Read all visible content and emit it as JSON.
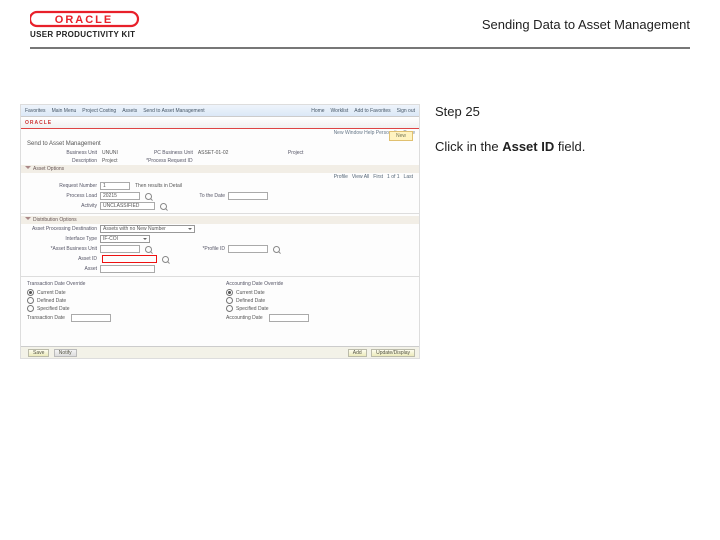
{
  "header": {
    "logo_text": "ORACLE",
    "upk": "USER PRODUCTIVITY KIT",
    "title": "Sending Data to Asset Management"
  },
  "rhs": {
    "step": "Step 25",
    "instr_pre": "Click in the ",
    "instr_bold": "Asset ID",
    "instr_post": " field."
  },
  "shot": {
    "topbar": {
      "favorites": "Favorites",
      "menu": "Main Menu",
      "pc": "Project Costing",
      "assets": "Assets",
      "send": "Send to Asset Management",
      "home": "Home",
      "worklist": "Worklist",
      "addfav": "Add to Favorites",
      "signout": "Sign out"
    },
    "brand": "ORACLE",
    "subhdr": "New Window   Help   Personalize Page",
    "page_title": "Send to Asset Management",
    "right_tab": "New",
    "trans": {
      "bu_lbl": "Business Unit",
      "bu_val": "UNUNI",
      "pc_lbl": "PC Business Unit",
      "pc_val": "ASSET-01-02",
      "proj_lbl": "Project",
      "proj_val": "",
      "desc_lbl": "Description",
      "desc_val": "Project",
      "proc_lbl": "*Process Request ID",
      "proc_val": "",
      "seq_lbl": "Request Number",
      "seq_val": "1",
      "seq_val2": "Then results in Detail",
      "prc_lbl": "Process Load",
      "prc_val": "20215",
      "todt_lbl": "To the Date",
      "todt_val": "",
      "act_lbl": "Activity",
      "act_val": "UNCLASSIFIED"
    },
    "nav": {
      "viewall": "View All",
      "first": "First",
      "range": "1 of 1",
      "last": "Last",
      "prof": "Profile"
    },
    "dist_hdr": "Distribution Options",
    "asset": {
      "dest_lbl": "Asset Processing Destination",
      "dest_val": "Assets with no New Number",
      "itype_lbl": "Interface Type",
      "itype_val": "IF-COI",
      "aubu_lbl": "*Asset Business Unit",
      "aubu_val": "",
      "aid_lbl": "Asset ID",
      "prof_lbl": "*Profile ID",
      "prof_val": "",
      "assetf_lbl": "Asset"
    },
    "override": {
      "left_title": "Transaction Date Override",
      "right_title": "Accounting Date Override",
      "curr": "Current Date",
      "def": "Defined Date",
      "spec": "Specified Date",
      "td_lbl": "Transaction Date",
      "ad_lbl": "Accounting Date"
    },
    "footer": {
      "save": "Save",
      "notify": "Notify",
      "add": "Add",
      "update": "Update/Display"
    }
  }
}
